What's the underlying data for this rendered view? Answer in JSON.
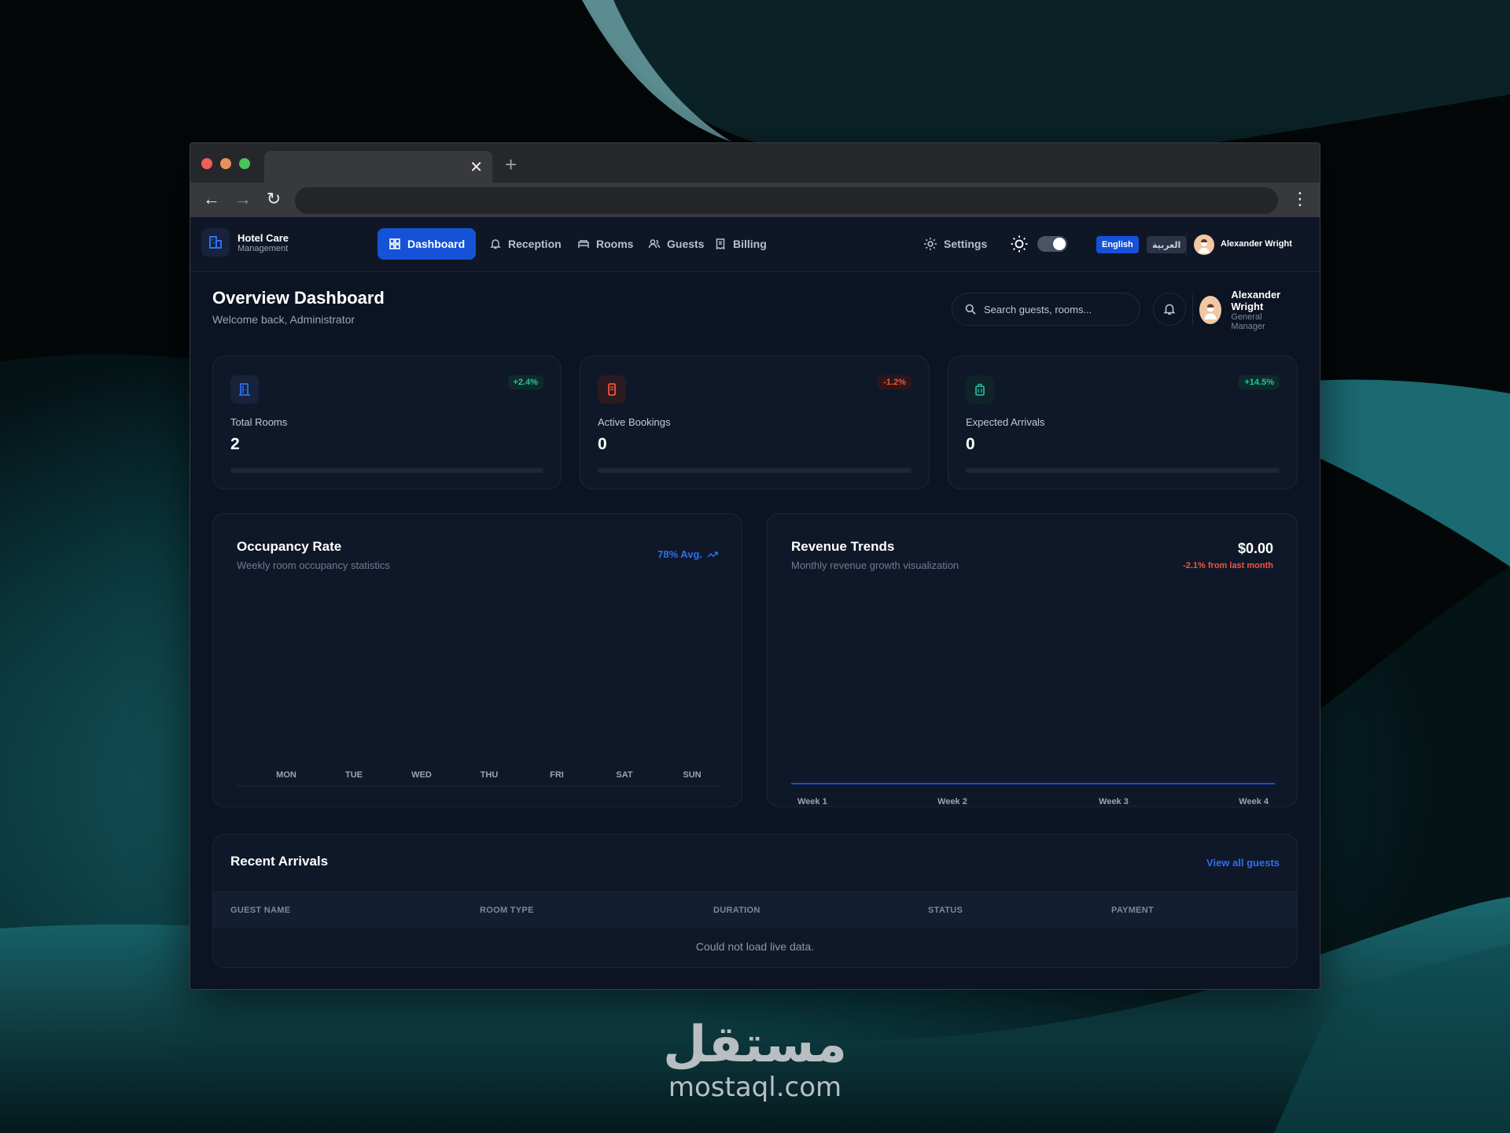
{
  "app": {
    "brand_title": "Hotel Care",
    "brand_subtitle": "Management",
    "nav": [
      {
        "label": "Dashboard",
        "icon": "grid-icon",
        "active": true
      },
      {
        "label": "Reception",
        "icon": "bell-icon"
      },
      {
        "label": "Rooms",
        "icon": "bed-icon"
      },
      {
        "label": "Guests",
        "icon": "users-icon"
      },
      {
        "label": "Billing",
        "icon": "receipt-icon"
      }
    ],
    "settings_label": "Settings",
    "lang_en": "English",
    "lang_ar": "العربية",
    "user_name": "Alexander Wright"
  },
  "header": {
    "title": "Overview Dashboard",
    "subtitle": "Welcome back, Administrator",
    "search_placeholder": "Search guests, rooms...",
    "user_name": "Alexander Wright",
    "user_role": "General Manager"
  },
  "stats": [
    {
      "label": "Total Rooms",
      "value": "2",
      "badge": "+2.4%",
      "badge_color": "#22c5a5",
      "icon": "door-icon",
      "icon_color": "#2f6ff0",
      "progress": 0
    },
    {
      "label": "Active Bookings",
      "value": "0",
      "badge": "-1.2%",
      "badge_color": "#f2553a",
      "icon": "phone-booking-icon",
      "icon_color": "#f2553a",
      "progress": 0
    },
    {
      "label": "Expected Arrivals",
      "value": "0",
      "badge": "+14.5%",
      "badge_color": "#22c5a5",
      "icon": "luggage-icon",
      "icon_color": "#22b0a0",
      "progress": 0
    }
  ],
  "occupancy": {
    "title": "Occupancy Rate",
    "subtitle": "Weekly room occupancy statistics",
    "avg": "78% Avg."
  },
  "revenue": {
    "title": "Revenue Trends",
    "subtitle": "Monthly revenue growth visualization",
    "value": "$0.00",
    "change": "-2.1% from last month"
  },
  "chart_data": [
    {
      "type": "bar",
      "title": "Occupancy Rate",
      "categories": [
        "MON",
        "TUE",
        "WED",
        "THU",
        "FRI",
        "SAT",
        "SUN"
      ],
      "values": [
        0,
        0,
        0,
        0,
        0,
        0,
        0
      ]
    },
    {
      "type": "line",
      "title": "Revenue Trends",
      "x": [
        "Week 1",
        "Week 2",
        "Week 3",
        "Week 4"
      ],
      "values": [
        0,
        0,
        0,
        0
      ],
      "color": "#1652d8"
    }
  ],
  "arrivals": {
    "title": "Recent Arrivals",
    "link": "View all guests",
    "columns": [
      "GUEST NAME",
      "ROOM TYPE",
      "DURATION",
      "STATUS",
      "PAYMENT"
    ],
    "empty_message": "Could not load live data."
  },
  "watermark": {
    "arabic": "مستقل",
    "latin": "mostaql.com"
  },
  "colors": {
    "accent": "#1652d8",
    "background": "#0c1322",
    "card": "#0f1829"
  }
}
